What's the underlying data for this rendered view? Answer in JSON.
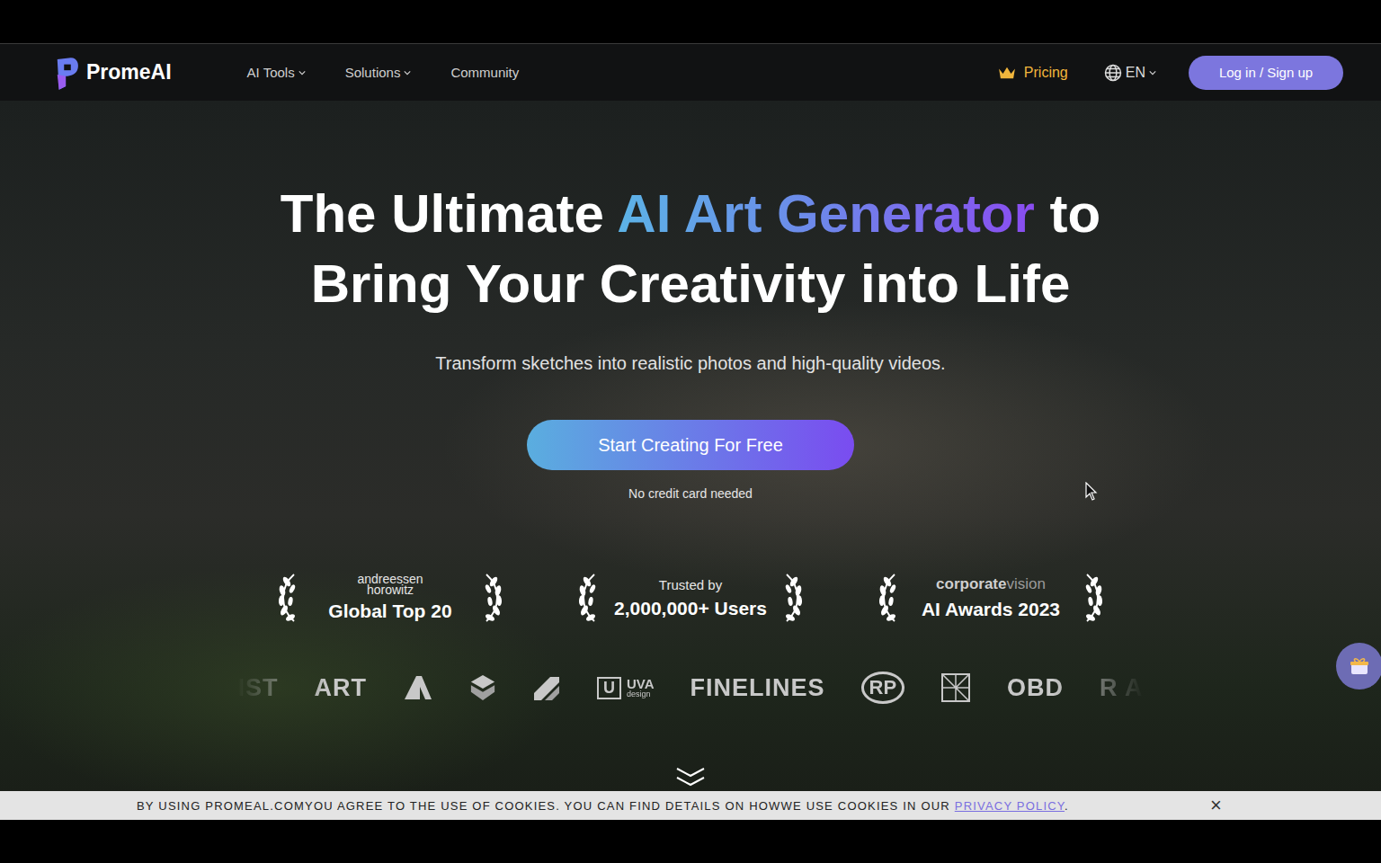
{
  "nav": {
    "brand": "PromeAI",
    "links": [
      {
        "label": "AI Tools",
        "dropdown": true
      },
      {
        "label": "Solutions",
        "dropdown": true
      },
      {
        "label": "Community",
        "dropdown": false
      }
    ],
    "pricing": "Pricing",
    "language": "EN",
    "login": "Log in / Sign up"
  },
  "hero": {
    "title_before": "The Ultimate ",
    "title_highlight": "AI Art Generator",
    "title_after": " to",
    "title_line2": "Bring Your Creativity into Life",
    "subtitle": "Transform sketches into realistic photos and high-quality videos.",
    "cta": "Start Creating For Free",
    "cta_note": "No credit card needed"
  },
  "awards": [
    {
      "kind": "stacked",
      "org": [
        "andreessen",
        "horowitz"
      ],
      "title": "Global Top 20"
    },
    {
      "kind": "plain",
      "org": [
        "Trusted by"
      ],
      "title": "2,000,000+ Users"
    },
    {
      "kind": "brand",
      "org": [
        "corporate",
        "vision"
      ],
      "title": "AI Awards 2023"
    }
  ],
  "partners": [
    {
      "kind": "text",
      "label": "IST"
    },
    {
      "kind": "text",
      "label": "ART"
    },
    {
      "kind": "peak",
      "label": ""
    },
    {
      "kind": "cube",
      "label": ""
    },
    {
      "kind": "slash",
      "label": ""
    },
    {
      "kind": "uva",
      "label": "U",
      "title": "UVA",
      "sub": "design"
    },
    {
      "kind": "text",
      "label": "FINELINES"
    },
    {
      "kind": "rp",
      "label": "RP"
    },
    {
      "kind": "grid",
      "label": ""
    },
    {
      "kind": "text",
      "label": "OBD"
    },
    {
      "kind": "text",
      "label": "R A"
    }
  ],
  "cookie_bar": {
    "text": "BY USING PROMEAL.COMYOU AGREE TO THE USE OF COOKIES. YOU CAN FIND DETAILS ON HOWWE USE COOKIES IN OUR",
    "link": "PRIVACY POLICY",
    "end": ".",
    "close": "×"
  }
}
